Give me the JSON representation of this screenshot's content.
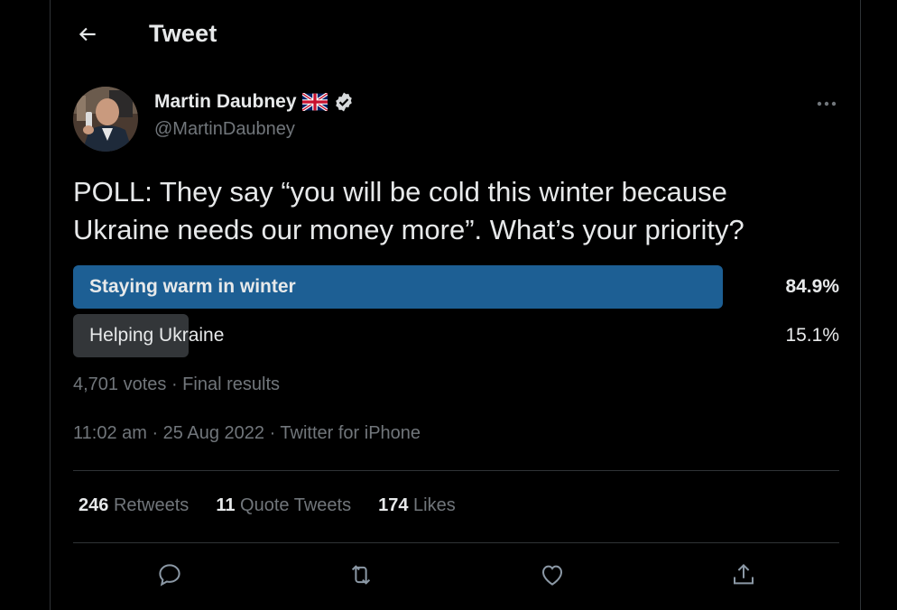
{
  "header": {
    "title": "Tweet"
  },
  "author": {
    "name": "Martin Daubney",
    "handle": "@MartinDaubney",
    "flag_emoji": "🇬🇧",
    "verified": true
  },
  "tweet": {
    "text": "POLL: They say “you will be cold this winter because Ukraine needs our money more”. What’s your priority?"
  },
  "poll": {
    "options": [
      {
        "label": "Staying warm in winter",
        "percent_text": "84.9%",
        "fraction": 0.849,
        "winner": true
      },
      {
        "label": "Helping Ukraine",
        "percent_text": "15.1%",
        "fraction": 0.151,
        "winner": false
      }
    ],
    "meta": "4,701 votes · Final results"
  },
  "timestamp": "11:02 am · 25 Aug 2022 · Twitter for iPhone",
  "stats": {
    "retweets_count": "246",
    "retweets_label": "Retweets",
    "quotes_count": "11",
    "quotes_label": "Quote Tweets",
    "likes_count": "174",
    "likes_label": "Likes"
  },
  "colors": {
    "accent_bar": "#1d5f94",
    "muted_bar": "#333639",
    "text": "#e7e9ea",
    "muted_text": "#71767b",
    "divider": "#2f3336",
    "icon": "#8b98a5"
  }
}
